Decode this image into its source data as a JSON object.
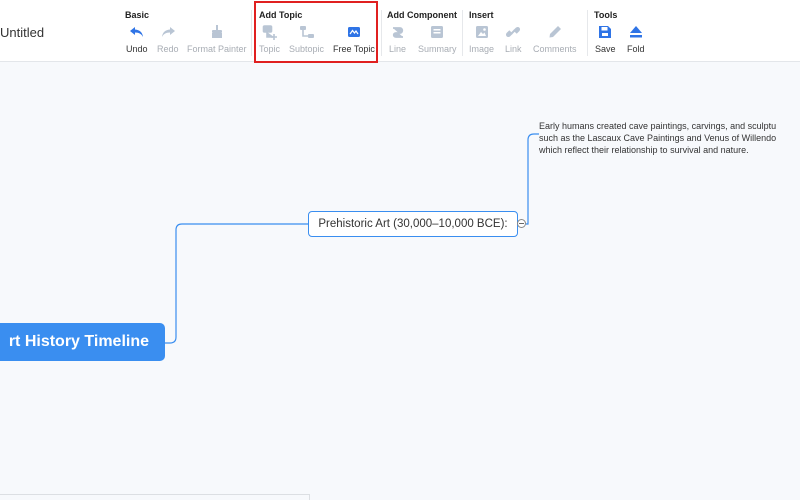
{
  "document": {
    "title": "Untitled"
  },
  "toolbar": {
    "groups": [
      {
        "label": "Basic",
        "tools": [
          {
            "label": "Undo",
            "icon": "undo-icon",
            "state": "active"
          },
          {
            "label": "Redo",
            "icon": "redo-icon",
            "state": "disabled"
          },
          {
            "label": "Format Painter",
            "icon": "format-painter-icon",
            "state": "disabled"
          }
        ]
      },
      {
        "label": "Add Topic",
        "tools": [
          {
            "label": "Topic",
            "icon": "topic-icon",
            "state": "disabled"
          },
          {
            "label": "Subtopic",
            "icon": "subtopic-icon",
            "state": "disabled"
          },
          {
            "label": "Free Topic",
            "icon": "free-topic-icon",
            "state": "active"
          }
        ]
      },
      {
        "label": "Add Component",
        "tools": [
          {
            "label": "Line",
            "icon": "line-icon",
            "state": "disabled"
          },
          {
            "label": "Summary",
            "icon": "summary-icon",
            "state": "disabled"
          }
        ]
      },
      {
        "label": "Insert",
        "tools": [
          {
            "label": "Image",
            "icon": "image-icon",
            "state": "disabled"
          },
          {
            "label": "Link",
            "icon": "link-icon",
            "state": "disabled"
          },
          {
            "label": "Comments",
            "icon": "comments-icon",
            "state": "disabled"
          }
        ]
      },
      {
        "label": "Tools",
        "tools": [
          {
            "label": "Save",
            "icon": "save-icon",
            "state": "active"
          },
          {
            "label": "Fold",
            "icon": "fold-icon",
            "state": "active"
          }
        ]
      }
    ]
  },
  "mindmap": {
    "root": {
      "label": "rt History Timeline"
    },
    "topic": {
      "label": "Prehistoric Art (30,000–10,000 BCE):"
    },
    "note": {
      "lines": [
        "Early humans created cave paintings, carvings, and sculptu",
        "such as the  Lascaux Cave Paintings and Venus of Willendo",
        "which reflect their relationship to survival and nature."
      ]
    }
  },
  "colors": {
    "accent": "#3a8ef0",
    "highlight_border": "#e02020",
    "disabled_icon": "#b9c5d4"
  }
}
